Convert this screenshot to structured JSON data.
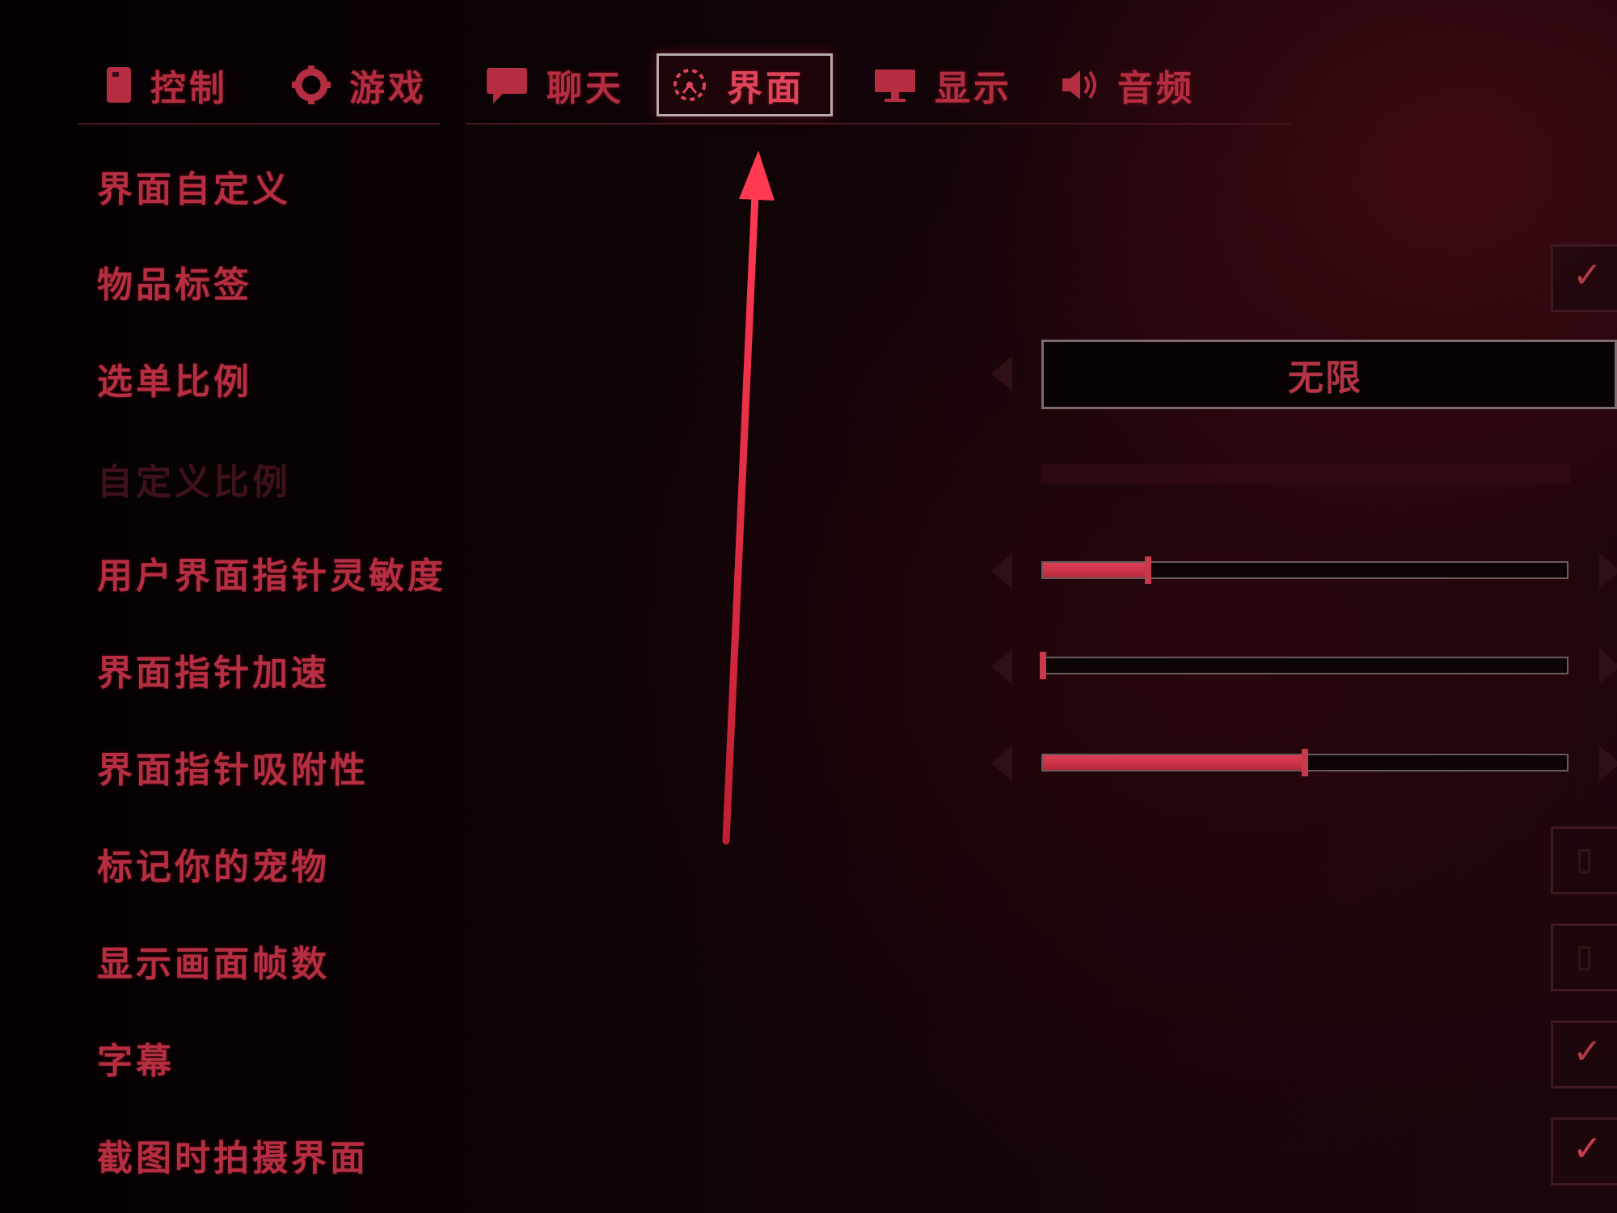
{
  "tabs": [
    {
      "label": "控制",
      "icon": "controller-icon",
      "active": false
    },
    {
      "label": "游戏",
      "icon": "gear-icon",
      "active": false
    },
    {
      "label": "聊天",
      "icon": "chat-bubble-icon",
      "active": false
    },
    {
      "label": "界面",
      "icon": "interface-icon",
      "active": true
    },
    {
      "label": "显示",
      "icon": "monitor-icon",
      "active": false
    },
    {
      "label": "音频",
      "icon": "speaker-icon",
      "active": false
    }
  ],
  "settings": {
    "ui_customize": {
      "label": "界面自定义"
    },
    "item_labels": {
      "label": "物品标签",
      "checked": true
    },
    "menu_scale": {
      "label": "选单比例",
      "value": "无限"
    },
    "custom_scale": {
      "label": "自定义比例",
      "disabled": true
    },
    "ui_pointer_sensitivity": {
      "label": "用户界面指针灵敏度",
      "level": 0.2
    },
    "ui_pointer_acceleration": {
      "label": "界面指针加速",
      "level": 0.0
    },
    "ui_pointer_snap": {
      "label": "界面指针吸附性",
      "level": 0.5
    },
    "mark_pets": {
      "label": "标记你的宠物",
      "checked": false
    },
    "show_fps": {
      "label": "显示画面帧数",
      "checked": false
    },
    "subtitles": {
      "label": "字幕",
      "checked": true
    },
    "hide_ui_on_screenshot": {
      "label": "截图时拍摄界面",
      "checked": true
    }
  },
  "colors": {
    "accent": "#e03e55",
    "text": "#b62e41",
    "background": "#070203"
  }
}
